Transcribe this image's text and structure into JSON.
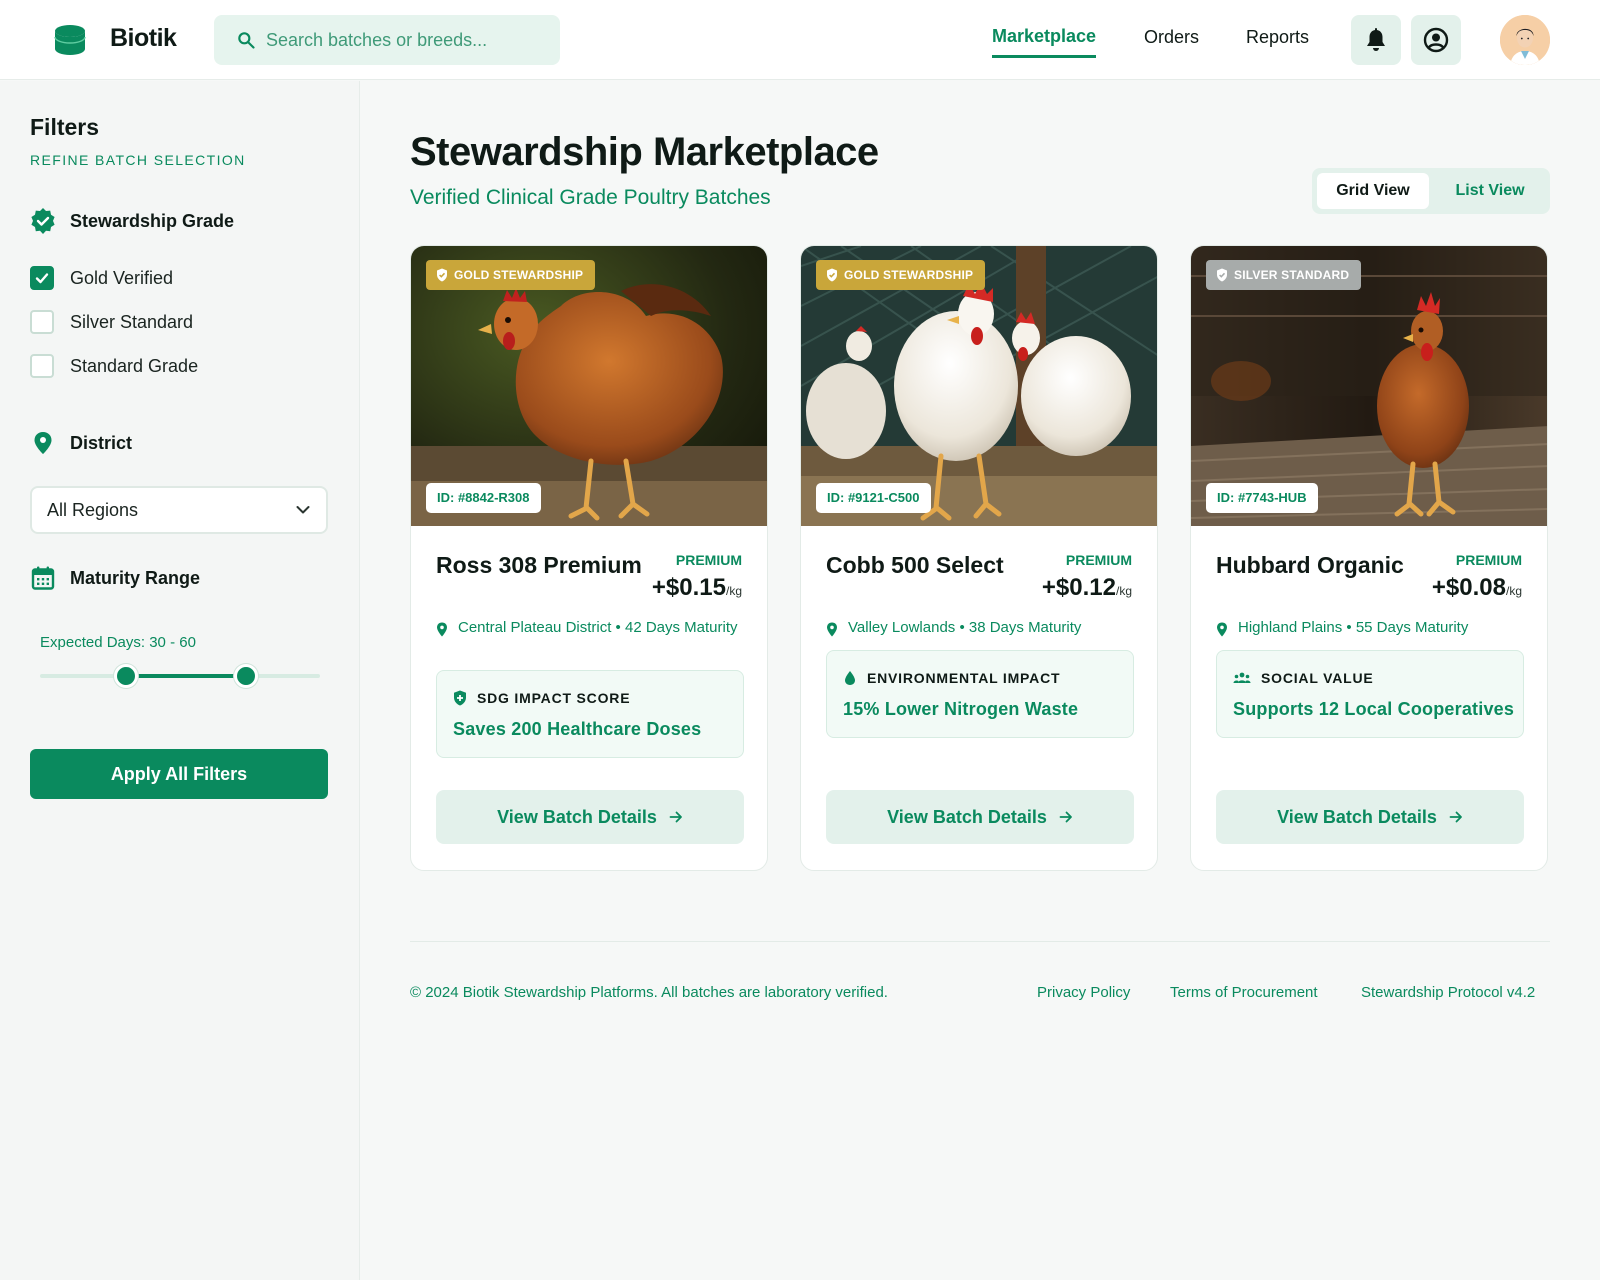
{
  "header": {
    "brand": "Biotik",
    "search_placeholder": "Search batches or breeds...",
    "nav": [
      "Marketplace",
      "Orders",
      "Reports"
    ],
    "active_nav": "Marketplace",
    "accent": "#0a8a5e"
  },
  "sidebar": {
    "title": "Filters",
    "subtitle": "REFINE BATCH SELECTION",
    "grade_heading": "Stewardship Grade",
    "grades": [
      {
        "label": "Gold Verified",
        "checked": true
      },
      {
        "label": "Silver Standard",
        "checked": false
      },
      {
        "label": "Standard Grade",
        "checked": false
      }
    ],
    "district_heading": "District",
    "district_value": "All Regions",
    "maturity_heading": "Maturity Range",
    "range_label": "Expected Days: 30 - 60",
    "range_min": 30,
    "range_max": 60,
    "apply_label": "Apply All Filters"
  },
  "main": {
    "title": "Stewardship Marketplace",
    "subtitle": "Verified Clinical Grade Poultry Batches",
    "view_toggle": {
      "grid": "Grid View",
      "list": "List View",
      "active": "Grid View"
    },
    "cards": [
      {
        "badge": "GOLD STEWARDSHIP",
        "badge_color": "#c9a63a",
        "id": "ID: #8842-R308",
        "name": "Ross 308 Premium",
        "tier": "PREMIUM",
        "price": "+$0.15",
        "unit": "/kg",
        "meta": "Central Plateau District • 42 Days Maturity",
        "impact_icon": "shield-plus-icon",
        "impact_title": "SDG IMPACT SCORE",
        "impact_value": "Saves 200 Healthcare Doses",
        "cta": "View Batch Details"
      },
      {
        "badge": "GOLD STEWARDSHIP",
        "badge_color": "#c9a63a",
        "id": "ID: #9121-C500",
        "name": "Cobb 500 Select",
        "tier": "PREMIUM",
        "price": "+$0.12",
        "unit": "/kg",
        "meta": "Valley Lowlands • 38 Days Maturity",
        "impact_icon": "water-drop-icon",
        "impact_title": "ENVIRONMENTAL IMPACT",
        "impact_value": "15% Lower Nitrogen Waste",
        "cta": "View Batch Details"
      },
      {
        "badge": "SILVER STANDARD",
        "badge_color": "#a7abaa",
        "id": "ID: #7743-HUB",
        "name": "Hubbard Organic",
        "tier": "PREMIUM",
        "price": "+$0.08",
        "unit": "/kg",
        "meta": "Highland Plains • 55 Days Maturity",
        "impact_icon": "group-icon",
        "impact_title": "SOCIAL VALUE",
        "impact_value": "Supports 12 Local Cooperatives",
        "cta": "View Batch Details"
      }
    ]
  },
  "footer": {
    "copyright": "© 2024 Biotik Stewardship Platforms. All batches are laboratory verified.",
    "links": [
      "Privacy Policy",
      "Terms of Procurement",
      "Stewardship Protocol v4.2"
    ]
  }
}
